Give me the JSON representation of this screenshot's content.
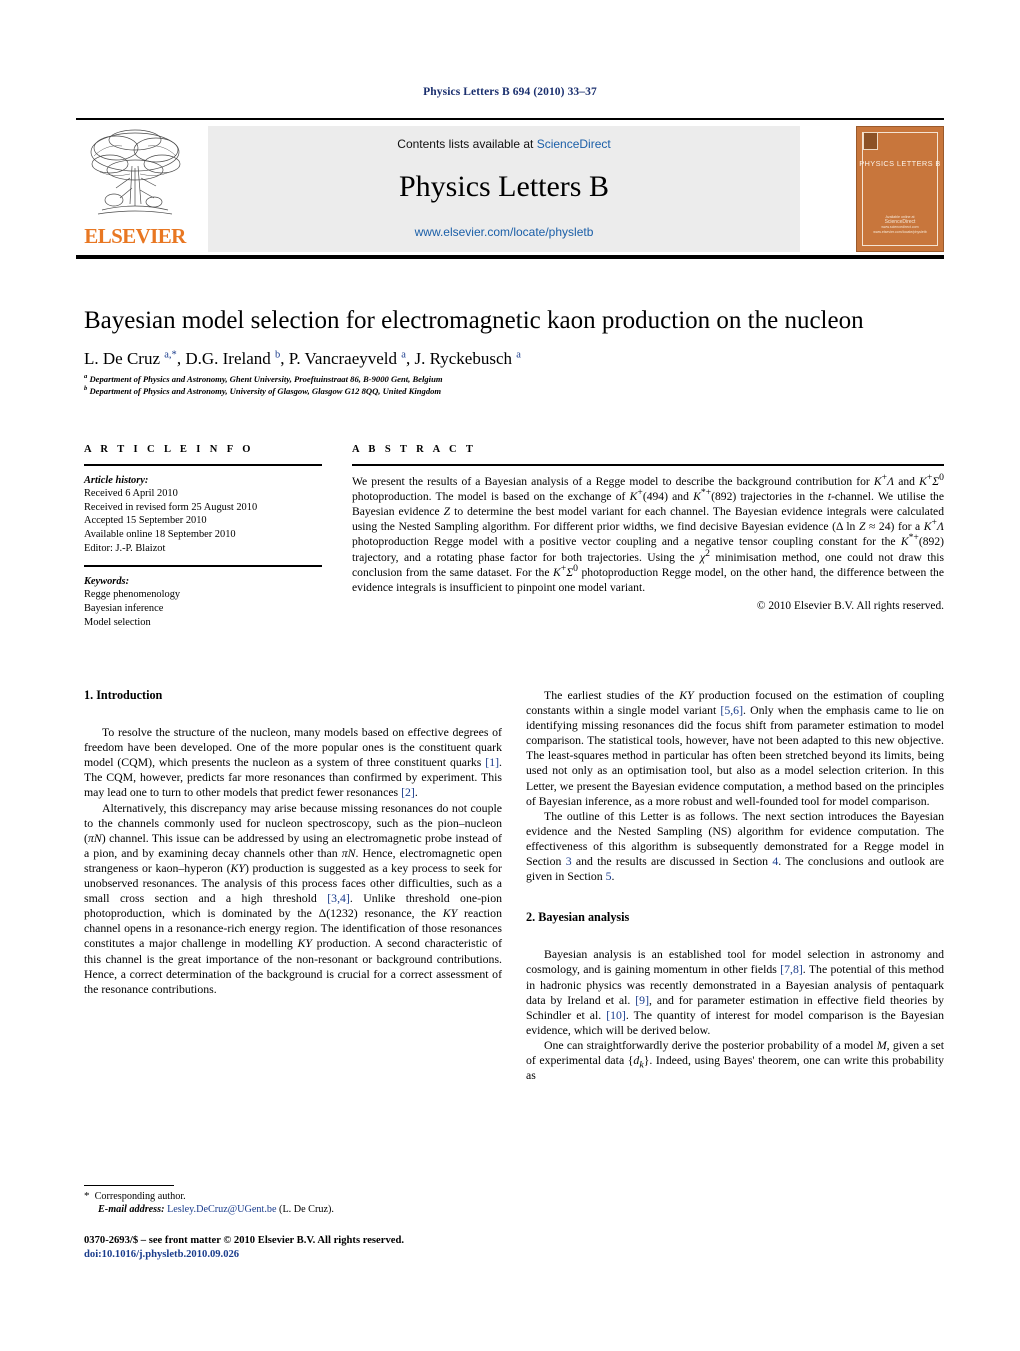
{
  "running_head": "Physics Letters B 694 (2010) 33–37",
  "masthead": {
    "contents_prefix": "Contents lists available at ",
    "contents_link": "ScienceDirect",
    "journal_title": "Physics Letters B",
    "journal_url": "www.elsevier.com/locate/physletb",
    "publisher_wordmark": "ELSEVIER",
    "cover": {
      "title": "PHYSICS LETTERS B",
      "foot_line1": "Available online at",
      "foot_line2": "ScienceDirect",
      "foot_line3": "www.sciencedirect.com",
      "foot_line4": "www.elsevier.com/locate/physletb"
    },
    "accent_orange": "#e87722",
    "link_blue": "#1b5fa8",
    "band_gray": "#ececec"
  },
  "article": {
    "title": "Bayesian model selection for electromagnetic kaon production on the nucleon",
    "authors_html": "L. De Cruz <sup>a,*</sup>, D.G. Ireland <sup>b</sup>, P. Vancraeyveld <sup>a</sup>, J. Ryckebusch <sup>a</sup>",
    "affiliation_a": "Department of Physics and Astronomy, Ghent University, Proeftuinstraat 86, B-9000 Gent, Belgium",
    "affiliation_b": "Department of Physics and Astronomy, University of Glasgow, Glasgow G12 8QQ, United Kingdom"
  },
  "info": {
    "heading": "A R T I C L E    I N F O",
    "history_label": "Article history:",
    "history": [
      "Received 6 April 2010",
      "Received in revised form 25 August 2010",
      "Accepted 15 September 2010",
      "Available online 18 September 2010",
      "Editor: J.-P. Blaizot"
    ],
    "keywords_label": "Keywords:",
    "keywords": [
      "Regge phenomenology",
      "Bayesian inference",
      "Model selection"
    ]
  },
  "abstract": {
    "heading": "A B S T R A C T",
    "text_html": "We present the results of a Bayesian analysis of a Regge model to describe the background contribution for <i>K</i><sup>+</sup><i>Λ</i> and <i>K</i><sup>+</sup><i>Σ</i><sup>0</sup> photoproduction. The model is based on the exchange of <i>K</i><sup>+</sup>(494) and <i>K</i><sup>*+</sup>(892) trajectories in the <i>t</i>-channel. We utilise the Bayesian evidence <i>Z</i> to determine the best model variant for each channel. The Bayesian evidence integrals were calculated using the Nested Sampling algorithm. For different prior widths, we find decisive Bayesian evidence (Δ ln <i>Z</i> ≈ 24) for a <i>K</i><sup>+</sup><i>Λ</i> photoproduction Regge model with a positive vector coupling and a negative tensor coupling constant for the <i>K</i><sup>*+</sup>(892) trajectory, and a rotating phase factor for both trajectories. Using the <i>χ</i><sup>2</sup> minimisation method, one could not draw this conclusion from the same dataset. For the <i>K</i><sup>+</sup><i>Σ</i><sup>0</sup> photoproduction Regge model, on the other hand, the difference between the evidence integrals is insufficient to pinpoint one model variant.",
    "copyright": "© 2010 Elsevier B.V. All rights reserved."
  },
  "body": {
    "section1_heading": "1. Introduction",
    "section2_heading": "2. Bayesian analysis",
    "p1_html": "To resolve the structure of the nucleon, many models based on effective degrees of freedom have been developed. One of the more popular ones is the constituent quark model (CQM), which presents the nucleon as a system of three constituent quarks <span class=\"ref\">[1]</span>. The CQM, however, predicts far more resonances than confirmed by experiment. This may lead one to turn to other models that predict fewer resonances <span class=\"ref\">[2]</span>.",
    "p2_html": "Alternatively, this discrepancy may arise because missing resonances do not couple to the channels commonly used for nucleon spectroscopy, such as the pion–nucleon (<i>πN</i>) channel. This issue can be addressed by using an electromagnetic probe instead of a pion, and by examining decay channels other than <i>πN</i>. Hence, electromagnetic open strangeness or kaon–hyperon (<i>KY</i>) production is suggested as a key process to seek for unobserved resonances. The analysis of this process faces other difficulties, such as a small cross section and a high threshold <span class=\"ref\">[3,4]</span>. Unlike threshold one-pion photoproduction, which is dominated by the Δ(1232) resonance, the <i>KY</i> reaction channel opens in a resonance-rich energy region. The identification of those resonances constitutes a major challenge in modelling <i>KY</i> production. A second characteristic of this channel is the great importance of the non-resonant or background contributions. Hence, a correct determination of the background is crucial for a correct assessment of the resonance contributions.",
    "p3_html": "The earliest studies of the <i>KY</i> production focused on the estimation of coupling constants within a single model variant <span class=\"ref\">[5,6]</span>. Only when the emphasis came to lie on identifying missing resonances did the focus shift from parameter estimation to model comparison. The statistical tools, however, have not been adapted to this new objective. The least-squares method in particular has often been stretched beyond its limits, being used not only as an optimisation tool, but also as a model selection criterion. In this Letter, we present the Bayesian evidence computation, a method based on the principles of Bayesian inference, as a more robust and well-founded tool for model comparison.",
    "p4_html": "The outline of this Letter is as follows. The next section introduces the Bayesian evidence and the Nested Sampling (NS) algorithm for evidence computation. The effectiveness of this algorithm is subsequently demonstrated for a Regge model in Section <span class=\"ref\">3</span> and the results are discussed in Section <span class=\"ref\">4</span>. The conclusions and outlook are given in Section <span class=\"ref\">5</span>.",
    "p5_html": "Bayesian analysis is an established tool for model selection in astronomy and cosmology, and is gaining momentum in other fields <span class=\"ref\">[7,8]</span>. The potential of this method in hadronic physics was recently demonstrated in a Bayesian analysis of pentaquark data by Ireland et al. <span class=\"ref\">[9]</span>, and for parameter estimation in effective field theories by Schindler et al. <span class=\"ref\">[10]</span>. The quantity of interest for model comparison is the Bayesian evidence, which will be derived below.",
    "p6_html": "One can straightforwardly derive the posterior probability of a model <i>M</i>, given a set of experimental data {<i>d<sub>k</sub></i>}. Indeed, using Bayes' theorem, one can write this probability as"
  },
  "footnotes": {
    "corresponding_marker": "*",
    "corresponding_text": "Corresponding author.",
    "email_label": "E-mail address:",
    "email": "Lesley.DeCruz@UGent.be",
    "email_owner": "(L. De Cruz).",
    "imprint": "0370-2693/$ – see front matter © 2010 Elsevier B.V. All rights reserved.",
    "doi": "doi:10.1016/j.physletb.2010.09.026"
  }
}
